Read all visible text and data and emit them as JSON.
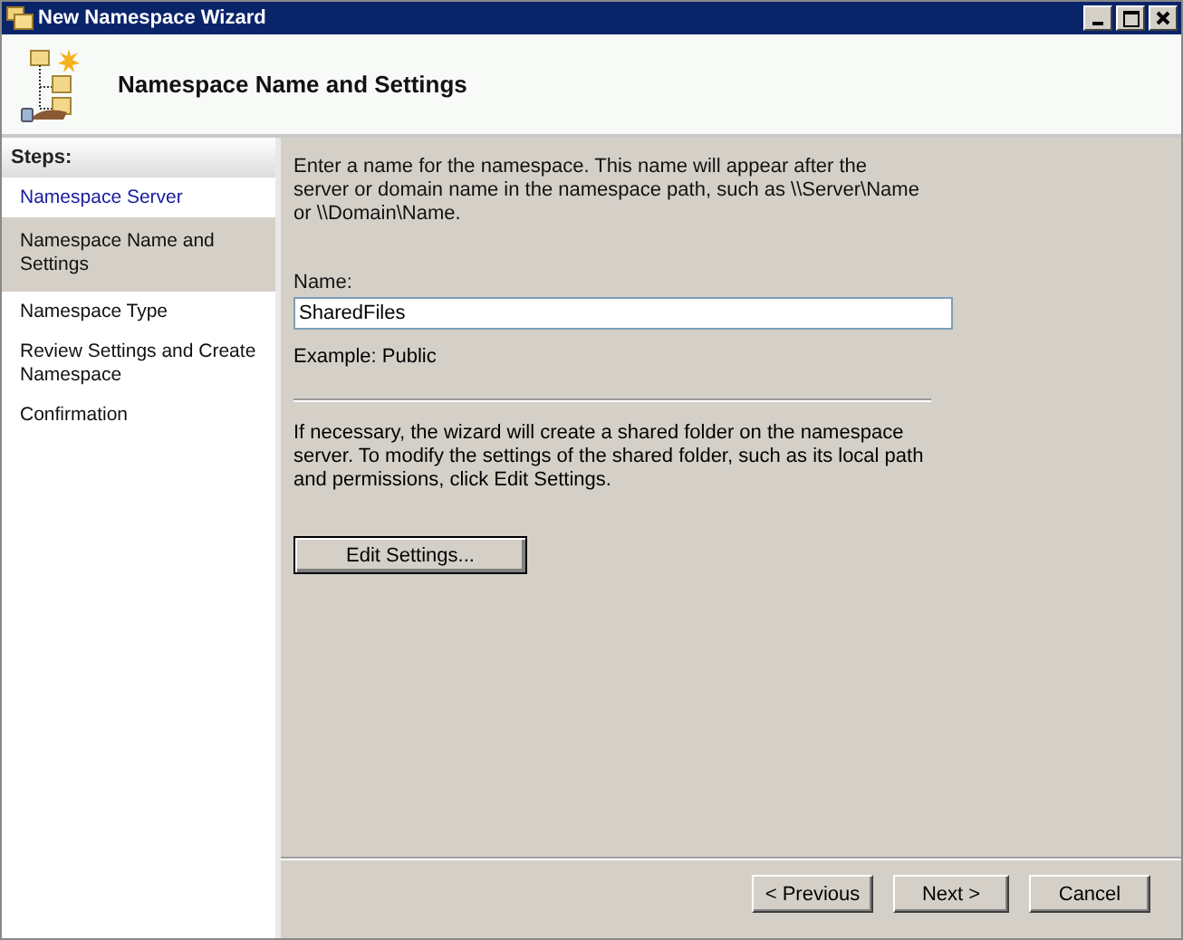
{
  "window": {
    "title": "New Namespace Wizard"
  },
  "header": {
    "title": "Namespace Name and Settings"
  },
  "sidebar": {
    "heading": "Steps:",
    "items": [
      {
        "label": "Namespace Server",
        "selected": false,
        "done": true
      },
      {
        "label": "Namespace Name and Settings",
        "selected": true,
        "done": false
      },
      {
        "label": "Namespace Type",
        "selected": false,
        "done": false
      },
      {
        "label": "Review Settings and Create Namespace",
        "selected": false,
        "done": false
      },
      {
        "label": "Confirmation",
        "selected": false,
        "done": false
      }
    ]
  },
  "content": {
    "intro": "Enter a name for the namespace. This name will appear after the server or domain name in the namespace path, such as \\\\Server\\Name or \\\\Domain\\Name.",
    "name_label": "Name:",
    "name_value": "SharedFiles",
    "example": "Example: Public",
    "note": "If necessary, the wizard will create a shared folder on the namespace server. To modify the settings of the shared folder, such as its local path and permissions, click Edit Settings.",
    "edit_button": "Edit Settings..."
  },
  "buttons": [
    "< Previous",
    "Next >",
    "Cancel"
  ]
}
